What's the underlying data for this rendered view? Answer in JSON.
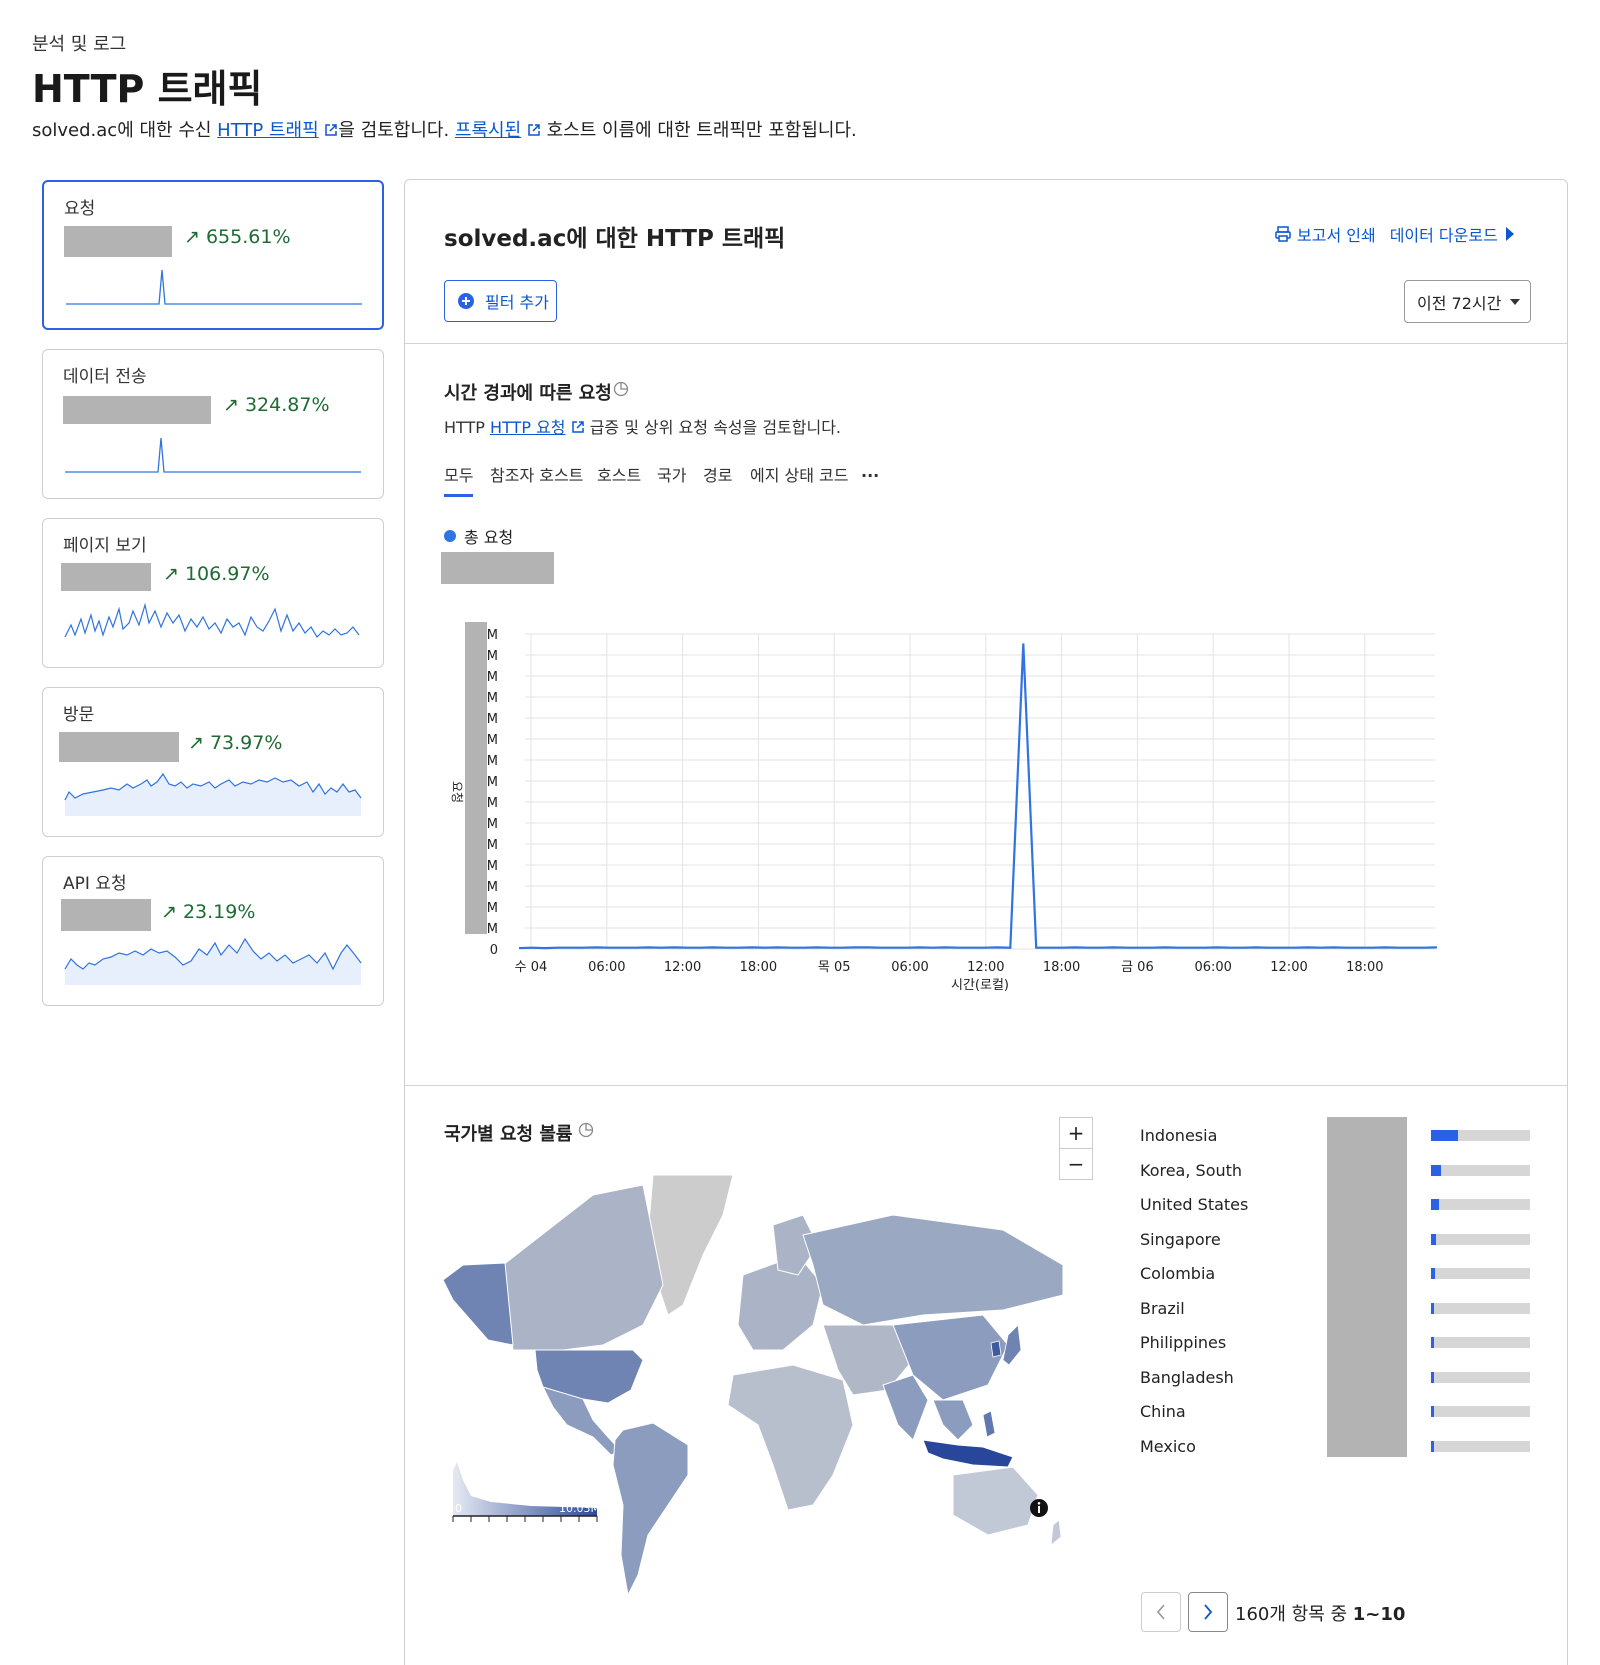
{
  "breadcrumb": "분석 및 로그",
  "page_title": "HTTP 트래픽",
  "subtitle": {
    "part1": "solved.ac에 대한 수신 ",
    "link1": "HTTP 트래픽",
    "part2": "을 검토합니다. ",
    "link2": "프록시된",
    "part3": " 호스트 이름에 대한 트래픽만 포함됩니다."
  },
  "cards": [
    {
      "label": "요청",
      "change": "655.61%"
    },
    {
      "label": "데이터 전송",
      "change": "324.87%"
    },
    {
      "label": "페이지 보기",
      "change": "106.97%"
    },
    {
      "label": "방문",
      "change": "73.97%"
    },
    {
      "label": "API 요청",
      "change": "23.19%"
    }
  ],
  "main": {
    "title": "solved.ac에 대한 HTTP 트래픽",
    "print_report": "보고서 인쇄",
    "download_data": "데이터 다운로드",
    "add_filter": "필터 추가",
    "time_range": "이전 72시간"
  },
  "requests_section": {
    "title": "시간 경과에 따른 요청",
    "desc_prefix": "HTTP ",
    "desc_link": "HTTP 요청",
    "desc_suffix": " 급증 및 상위 요청 속성을 검토합니다.",
    "tabs": [
      "모두",
      "참조자 호스트",
      "호스트",
      "국가",
      "경로",
      "에지 상태 코드",
      "..."
    ],
    "legend": "총 요청"
  },
  "chart_data": {
    "type": "line",
    "series": [
      {
        "name": "총 요청",
        "color": "#2f74e0"
      }
    ],
    "x_ticks": [
      "수 04",
      "06:00",
      "12:00",
      "18:00",
      "목 05",
      "06:00",
      "12:00",
      "18:00",
      "금 06",
      "06:00",
      "12:00",
      "18:00"
    ],
    "y_ticks": [
      "M",
      "M",
      "M",
      "M",
      "M",
      "M",
      "M",
      "M",
      "M",
      "M",
      "M",
      "M",
      "M",
      "M",
      "M",
      "0"
    ],
    "xlabel": "시간(로컬)",
    "ylabel": "요청",
    "grid": true,
    "values_note_peak_index": 39,
    "values": [
      0.003,
      0.004,
      0.003,
      0.004,
      0.004,
      0.004,
      0.005,
      0.004,
      0.004,
      0.004,
      0.005,
      0.004,
      0.005,
      0.004,
      0.004,
      0.005,
      0.004,
      0.004,
      0.005,
      0.004,
      0.005,
      0.004,
      0.004,
      0.005,
      0.004,
      0.004,
      0.005,
      0.005,
      0.004,
      0.004,
      0.004,
      0.005,
      0.004,
      0.005,
      0.004,
      0.004,
      0.004,
      0.005,
      0.004,
      0.97,
      0.004,
      0.004,
      0.004,
      0.005,
      0.004,
      0.004,
      0.005,
      0.004,
      0.004,
      0.004,
      0.005,
      0.004,
      0.004,
      0.004,
      0.005,
      0.004,
      0.004,
      0.005,
      0.004,
      0.004,
      0.004,
      0.005,
      0.004,
      0.005,
      0.004,
      0.004,
      0.004,
      0.005,
      0.004,
      0.004,
      0.004,
      0.005
    ]
  },
  "country_section": {
    "title": "국가별 요청 볼륨",
    "scale_min": "0",
    "scale_max": "10.03M",
    "zoom_in": "+",
    "zoom_out": "−",
    "countries": [
      {
        "name": "Indonesia",
        "share": 0.27
      },
      {
        "name": "Korea, South",
        "share": 0.1
      },
      {
        "name": "United States",
        "share": 0.08
      },
      {
        "name": "Singapore",
        "share": 0.05
      },
      {
        "name": "Colombia",
        "share": 0.04
      },
      {
        "name": "Brazil",
        "share": 0.035
      },
      {
        "name": "Philippines",
        "share": 0.03
      },
      {
        "name": "Bangladesh",
        "share": 0.03
      },
      {
        "name": "China",
        "share": 0.03
      },
      {
        "name": "Mexico",
        "share": 0.03
      }
    ],
    "pagination_prefix": "160개 항목 중 ",
    "pagination_range": "1~10"
  },
  "colors": {
    "accent": "#2b62e5",
    "positive": "#1f6b34",
    "redacted": "#b3b3b3"
  }
}
